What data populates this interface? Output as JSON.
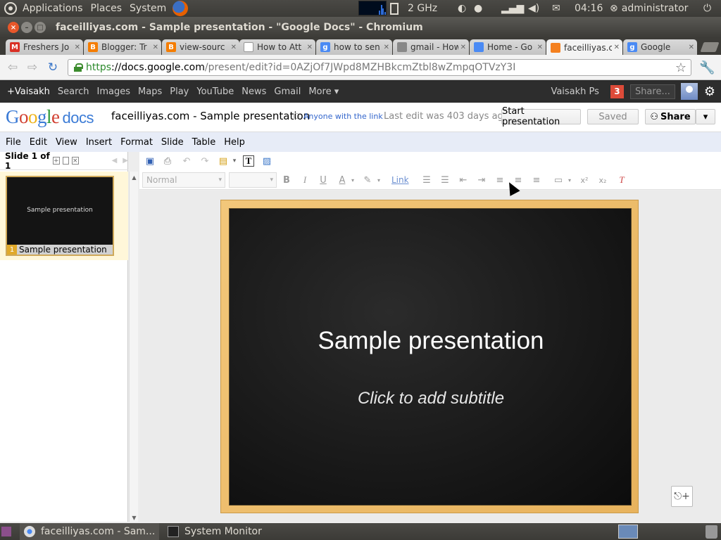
{
  "top_panel": {
    "menus": [
      "Applications",
      "Places",
      "System"
    ],
    "cpu_freq": "2 GHz",
    "clock": "04:16",
    "user": "administrator"
  },
  "window": {
    "title": "faceilliyas.com - Sample presentation - \"Google Docs\" - Chromium"
  },
  "tabs": [
    {
      "label": "Freshers Jo",
      "favicon": "gmail-icon",
      "color": "#d93025",
      "glyph": "M"
    },
    {
      "label": "Blogger: Tr",
      "favicon": "blogger-icon",
      "color": "#f57d00",
      "glyph": "B"
    },
    {
      "label": "view-sourc",
      "favicon": "blogger-icon",
      "color": "#f57d00",
      "glyph": "B"
    },
    {
      "label": "How to Att",
      "favicon": "page-icon",
      "color": "#ffffff",
      "glyph": ""
    },
    {
      "label": "how to sen",
      "favicon": "google-icon",
      "color": "#4a8af4",
      "glyph": "g"
    },
    {
      "label": "gmail - How",
      "favicon": "cloud-icon",
      "color": "#888888",
      "glyph": ""
    },
    {
      "label": "Home - Go",
      "favicon": "docs-icon",
      "color": "#4a8af4",
      "glyph": ""
    },
    {
      "label": "faceilliyas.c",
      "favicon": "slides-icon",
      "color": "#f4801f",
      "glyph": ""
    },
    {
      "label": "Google",
      "favicon": "google-icon",
      "color": "#4a8af4",
      "glyph": "g"
    }
  ],
  "omnibox": {
    "scheme": "https",
    "host": "://docs.google.com",
    "path": "/present/edit?id=0AZjOf7JWpd8MZHBkcmZtbl8wZmpqOTVzY3I"
  },
  "gbar": {
    "links": [
      "+Vaisakh",
      "Search",
      "Images",
      "Maps",
      "Play",
      "YouTube",
      "News",
      "Gmail",
      "More ▾"
    ],
    "user_name": "Vaisakh Ps",
    "notifications": "3",
    "share_label": "Share..."
  },
  "docs_header": {
    "logo_google": "Google",
    "logo_docs": "docs",
    "doc_title": "faceilliyas.com - Sample presentation",
    "sharing": "Anyone with the link",
    "last_edit": "Last edit was 403 days ago",
    "start_presentation": "Start presentation",
    "saved": "Saved",
    "share": "Share"
  },
  "menubar": [
    "File",
    "Edit",
    "View",
    "Insert",
    "Format",
    "Slide",
    "Table",
    "Help"
  ],
  "slide_panel": {
    "header": "Slide 1 of 1",
    "thumb_title": "Sample presentation",
    "thumb_num": "1",
    "thumb_label": "Sample presentation"
  },
  "format_toolbar": {
    "style_value": "Normal",
    "link_label": "Link"
  },
  "slide": {
    "title": "Sample presentation",
    "subtitle": "Click to add subtitle"
  },
  "taskbar": [
    {
      "label": "faceilliyas.com - Sam...",
      "active": true
    },
    {
      "label": "System Monitor",
      "active": false
    }
  ]
}
